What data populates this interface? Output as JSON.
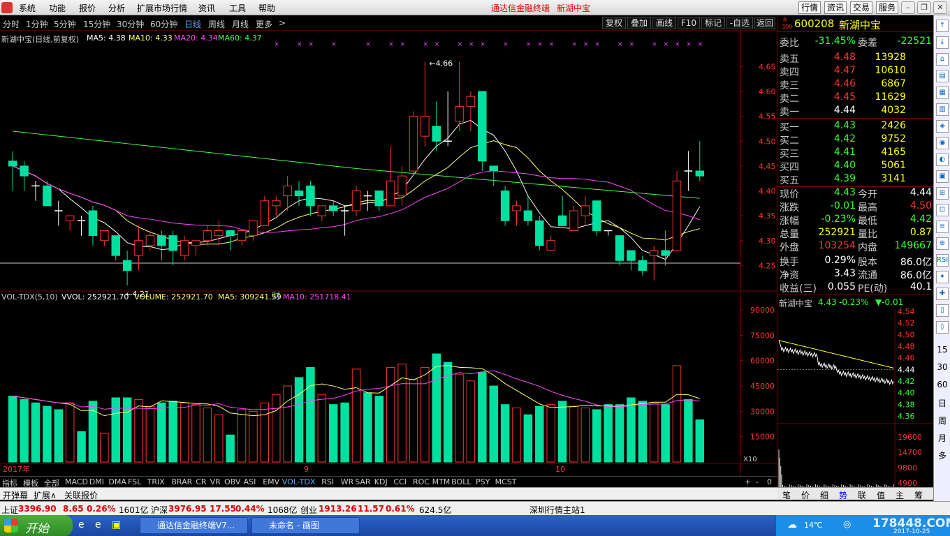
{
  "menubar": {
    "items": [
      "系统",
      "功能",
      "报价",
      "分析",
      "扩展市场行情",
      "资讯",
      "工具",
      "帮助"
    ],
    "app_title": "通达信金融终端",
    "stock_title": "新湖中宝",
    "right_buttons": [
      "行情",
      "资讯",
      "交易",
      "服务"
    ]
  },
  "periods": [
    "分时",
    "1分钟",
    "5分钟",
    "15分钟",
    "30分钟",
    "60分钟",
    "日线",
    "周线",
    "月线",
    "更多",
    ">"
  ],
  "active_period": "日线",
  "toolbar_buttons": [
    "复权",
    "叠加",
    "画线",
    "F10",
    "标记",
    "-自选",
    "返回"
  ],
  "kline": {
    "title": "新湖中宝(日线,前复权)",
    "ma5_label": "MA5: 4.38",
    "ma10_label": "MA10: 4.33",
    "ma20_label": "MA20: 4.34",
    "ma60_label": "MA60: 4.37",
    "price_ticks": [
      "4.65",
      "4.60",
      "4.55",
      "4.50",
      "4.45",
      "4.40",
      "4.35",
      "4.30",
      "4.25"
    ],
    "high_mark": "4.66",
    "low_mark": "4.21",
    "cai_marker": "财",
    "colors": {
      "up": "#ff3232",
      "down": "#00e0a0",
      "ma5": "#ffffff",
      "ma10": "#ffff66",
      "ma20": "#ff44ff",
      "ma60": "#44ff44"
    }
  },
  "volume": {
    "title": "VOL-TDX(5,10)",
    "vvol": "VVOL: 252921.70",
    "volume": "VOLUME: 252921.70",
    "ma5": "MA5: 309241.59",
    "ma10": "MA10: 251718.41",
    "ticks": [
      "90000",
      "75000",
      "60000",
      "45000",
      "30000",
      "15000"
    ],
    "unit": "X10",
    "x_labels": [
      "2017年",
      "9",
      "10"
    ]
  },
  "quote": {
    "code": "600208",
    "name": "新湖中宝",
    "weibi_label": "委比",
    "weibi": "-31.45%",
    "weicha_label": "委差",
    "weicha": "-22521",
    "sell": [
      {
        "label": "卖五",
        "price": "4.48",
        "vol": "13928"
      },
      {
        "label": "卖四",
        "price": "4.47",
        "vol": "10610"
      },
      {
        "label": "卖三",
        "price": "4.46",
        "vol": "6867"
      },
      {
        "label": "卖二",
        "price": "4.45",
        "vol": "11629"
      },
      {
        "label": "卖一",
        "price": "4.44",
        "vol": "4032"
      }
    ],
    "buy": [
      {
        "label": "买一",
        "price": "4.43",
        "vol": "2426"
      },
      {
        "label": "买二",
        "price": "4.42",
        "vol": "9752"
      },
      {
        "label": "买三",
        "price": "4.41",
        "vol": "4165"
      },
      {
        "label": "买四",
        "price": "4.40",
        "vol": "5061"
      },
      {
        "label": "买五",
        "price": "4.39",
        "vol": "3141"
      }
    ],
    "stats": [
      {
        "l1": "现价",
        "v1": "4.43",
        "c1": "down",
        "l2": "今开",
        "v2": "4.44",
        "c2": "wht"
      },
      {
        "l1": "涨跌",
        "v1": "-0.01",
        "c1": "down",
        "l2": "最高",
        "v2": "4.50",
        "c2": "up"
      },
      {
        "l1": "涨幅",
        "v1": "-0.23%",
        "c1": "down",
        "l2": "最低",
        "v2": "4.42",
        "c2": "down"
      },
      {
        "l1": "总量",
        "v1": "252921",
        "c1": "yel",
        "l2": "量比",
        "v2": "0.87",
        "c2": "yel"
      },
      {
        "l1": "外盘",
        "v1": "103254",
        "c1": "up",
        "l2": "内盘",
        "v2": "149667",
        "c2": "down"
      },
      {
        "l1": "换手",
        "v1": "0.29%",
        "c1": "wht",
        "l2": "股本",
        "v2": "86.0亿",
        "c2": "wht"
      },
      {
        "l1": "净资",
        "v1": "3.43",
        "c1": "wht",
        "l2": "流通",
        "v2": "86.0亿",
        "c2": "wht"
      },
      {
        "l1": "收益(三)",
        "v1": "0.055",
        "c1": "wht",
        "l2": "PE(动)",
        "v2": "40.1",
        "c2": "wht"
      }
    ]
  },
  "mini": {
    "title": "新湖中宝",
    "price": "4.43",
    "change": "-0.23%",
    "delta": "▼-0.01",
    "price_ticks": [
      "4.54",
      "4.52",
      "4.50",
      "4.48",
      "4.46",
      "4.44",
      "4.42",
      "4.40",
      "4.38",
      "4.36"
    ],
    "vol_ticks": [
      "19600",
      "14700",
      "9800",
      "4900"
    ],
    "side_labels": [
      "15",
      "30",
      "60",
      "日",
      "周",
      "月",
      "多"
    ]
  },
  "indicator_tabs": [
    "指标",
    "模板",
    "全部",
    "MACD",
    "DMI",
    "DMA",
    "FSL",
    "TRIX",
    "BRAR",
    "CR",
    "VR",
    "OBV",
    "ASI",
    "EMV",
    "VOL-TDX",
    "RSI",
    "WR",
    "SAR",
    "KDJ",
    "CCI",
    "ROC",
    "MTM",
    "BOLL",
    "PSY",
    "MCST"
  ],
  "active_indicator": "VOL-TDX",
  "sub_tabs": [
    "开弹幕",
    "扩展∧",
    "关联报价"
  ],
  "right_tabs": [
    "笔",
    "价",
    "细",
    "势",
    "联",
    "值",
    "主",
    "筹"
  ],
  "active_right_tab": "势",
  "status": {
    "sh_label": "上证",
    "sh_value": "3396.90",
    "sh_change": "8.65",
    "sh_pct": "0.26%",
    "sh_amt": "1601亿",
    "hs_label": "沪深",
    "hs_value": "3976.95",
    "hs_change": "17.55",
    "hs_pct": "0.44%",
    "hs_amt": "1068亿",
    "cy_label": "创业",
    "cy_value": "1913.26",
    "cy_change": "11.57",
    "cy_pct": "0.61%",
    "cy_amt": "624.5亿",
    "station": "深圳行情主站1"
  },
  "taskbar": {
    "start": "开始",
    "tasks": [
      "通达信金融终端V7...",
      "未命名 - 画图"
    ],
    "temp": "14℃",
    "watermark": "178448.COM",
    "date": "2017-10-25"
  },
  "chart_data": {
    "type": "candlestick",
    "y_price_range": [
      4.2,
      4.68
    ],
    "candles": [
      [
        4.46,
        4.45,
        4.48,
        4.4
      ],
      [
        4.45,
        4.43,
        4.46,
        4.4
      ],
      [
        4.41,
        4.41,
        4.42,
        4.38
      ],
      [
        4.41,
        4.37,
        4.42,
        4.37
      ],
      [
        4.36,
        4.36,
        4.38,
        4.33
      ],
      [
        4.34,
        4.35,
        4.35,
        4.32
      ],
      [
        4.34,
        4.34,
        4.35,
        4.31
      ],
      [
        4.36,
        4.31,
        4.37,
        4.29
      ],
      [
        4.3,
        4.32,
        4.32,
        4.29
      ],
      [
        4.31,
        4.27,
        4.31,
        4.26
      ],
      [
        4.26,
        4.24,
        4.28,
        4.21
      ],
      [
        4.27,
        4.3,
        4.33,
        4.24
      ],
      [
        4.29,
        4.31,
        4.32,
        4.28
      ],
      [
        4.31,
        4.29,
        4.32,
        4.26
      ],
      [
        4.31,
        4.28,
        4.32,
        4.25
      ],
      [
        4.27,
        4.3,
        4.31,
        4.26
      ],
      [
        4.29,
        4.3,
        4.3,
        4.27
      ],
      [
        4.3,
        4.32,
        4.33,
        4.29
      ],
      [
        4.31,
        4.32,
        4.34,
        4.29
      ],
      [
        4.32,
        4.31,
        4.32,
        4.28
      ],
      [
        4.3,
        4.32,
        4.32,
        4.29
      ],
      [
        4.31,
        4.34,
        4.34,
        4.3
      ],
      [
        4.33,
        4.38,
        4.39,
        4.33
      ],
      [
        4.37,
        4.38,
        4.39,
        4.35
      ],
      [
        4.39,
        4.41,
        4.43,
        4.36
      ],
      [
        4.4,
        4.39,
        4.42,
        4.37
      ],
      [
        4.41,
        4.37,
        4.42,
        4.35
      ],
      [
        4.35,
        4.37,
        4.37,
        4.34
      ],
      [
        4.37,
        4.36,
        4.38,
        4.35
      ],
      [
        4.36,
        4.36,
        4.37,
        4.31
      ],
      [
        4.36,
        4.4,
        4.41,
        4.35
      ],
      [
        4.39,
        4.39,
        4.4,
        4.36
      ],
      [
        4.4,
        4.37,
        4.4,
        4.36
      ],
      [
        4.37,
        4.42,
        4.49,
        4.37
      ],
      [
        4.39,
        4.43,
        4.45,
        4.37
      ],
      [
        4.44,
        4.55,
        4.56,
        4.43
      ],
      [
        4.51,
        4.55,
        4.66,
        4.49
      ],
      [
        4.53,
        4.5,
        4.58,
        4.48
      ],
      [
        4.5,
        4.5,
        4.6,
        4.49
      ],
      [
        4.54,
        4.57,
        4.66,
        4.52
      ],
      [
        4.57,
        4.59,
        4.6,
        4.52
      ],
      [
        4.6,
        4.46,
        4.6,
        4.44
      ],
      [
        4.45,
        4.44,
        4.45,
        4.41
      ],
      [
        4.4,
        4.34,
        4.41,
        4.33
      ],
      [
        4.36,
        4.37,
        4.38,
        4.33
      ],
      [
        4.36,
        4.34,
        4.39,
        4.33
      ],
      [
        4.34,
        4.29,
        4.35,
        4.28
      ],
      [
        4.28,
        4.3,
        4.31,
        4.28
      ],
      [
        4.35,
        4.33,
        4.39,
        4.33
      ],
      [
        4.32,
        4.36,
        4.37,
        4.32
      ],
      [
        4.35,
        4.37,
        4.39,
        4.33
      ],
      [
        4.38,
        4.32,
        4.38,
        4.31
      ],
      [
        4.32,
        4.32,
        4.32,
        4.31
      ],
      [
        4.31,
        4.26,
        4.31,
        4.25
      ],
      [
        4.28,
        4.26,
        4.28,
        4.24
      ],
      [
        4.26,
        4.24,
        4.27,
        4.23
      ],
      [
        4.27,
        4.28,
        4.29,
        4.22
      ],
      [
        4.28,
        4.27,
        4.32,
        4.25
      ],
      [
        4.28,
        4.42,
        4.44,
        4.28
      ],
      [
        4.44,
        4.44,
        4.48,
        4.4
      ],
      [
        4.44,
        4.43,
        4.5,
        4.42
      ]
    ],
    "volumes": [
      39000,
      37000,
      35000,
      33000,
      31000,
      35000,
      18000,
      36000,
      17000,
      38000,
      38000,
      37000,
      33000,
      35000,
      36000,
      35000,
      34000,
      32000,
      28000,
      16000,
      31000,
      30000,
      35000,
      40000,
      45000,
      50000,
      56000,
      40000,
      34000,
      35000,
      55000,
      41000,
      39000,
      56000,
      58000,
      49000,
      56000,
      64000,
      59000,
      52000,
      48000,
      53000,
      45000,
      34000,
      32000,
      28000,
      33000,
      34000,
      36000,
      33000,
      32000,
      31000,
      34000,
      34000,
      38000,
      36000,
      35000,
      34000,
      57000,
      37000,
      25000
    ]
  }
}
